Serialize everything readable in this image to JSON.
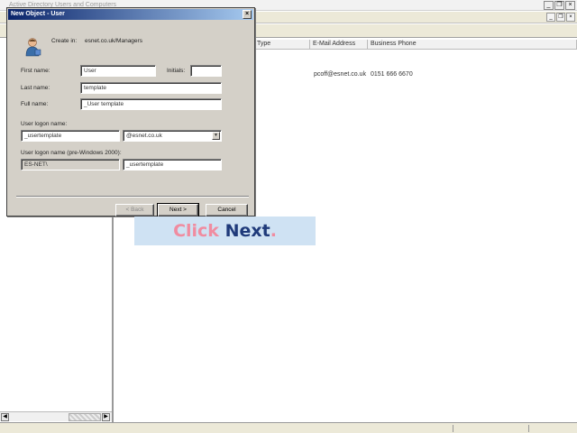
{
  "console": {
    "title": "Active Directory Users and Computers",
    "columns": [
      "",
      "Type",
      "E-Mail Address",
      "Business Phone"
    ],
    "row": {
      "email": "pcoff@esnet.co.uk",
      "phone": "0151 666 6670"
    }
  },
  "dialog": {
    "title": "New Object - User",
    "create_in_label": "Create in:",
    "create_in_value": "esnet.co.uk/Managers",
    "first_name_label": "First name:",
    "first_name_value": "User",
    "initials_label": "Initials:",
    "initials_value": "",
    "last_name_label": "Last name:",
    "last_name_value": "template",
    "full_name_label": "Full name:",
    "full_name_value": "_User template",
    "logon_label": "User logon name:",
    "logon_value": "_usertemplate",
    "domain_value": "@esnet.co.uk",
    "pre2000_label": "User logon name (pre-Windows 2000):",
    "pre2000_domain": "ES-NET\\",
    "pre2000_value": "_usertemplate",
    "back_label": "< Back",
    "next_label": "Next >",
    "cancel_label": "Cancel"
  },
  "callout": {
    "word1": "Click",
    "word2": "Next",
    "punct": "."
  },
  "colors": {
    "callout_bg": "#cfe2f3",
    "callout_pink": "#f08ca0",
    "callout_navy": "#1f3a7a",
    "titlebar_start": "#0a246a",
    "titlebar_end": "#a6caf0"
  }
}
